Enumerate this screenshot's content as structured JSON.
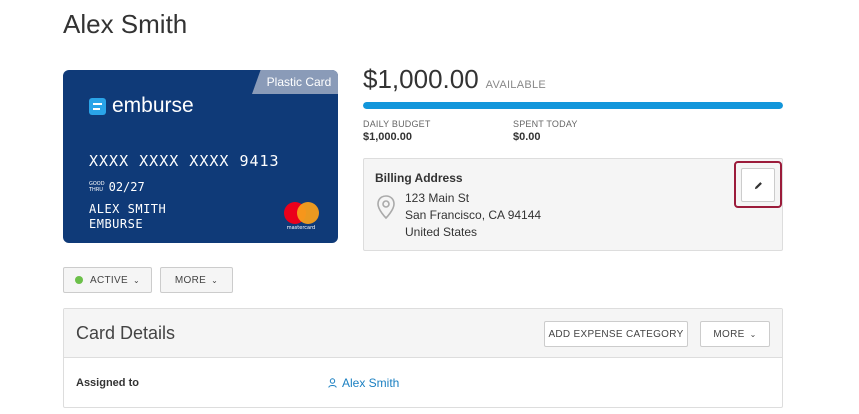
{
  "page": {
    "title": "Alex Smith"
  },
  "card": {
    "tab_label": "Plastic Card",
    "brand": "emburse",
    "number": "XXXX XXXX XXXX 9413",
    "good_thru_label_line1": "GOOD",
    "good_thru_label_line2": "THRU",
    "expiry": "02/27",
    "holder_line1": "ALEX SMITH",
    "holder_line2": "EMBURSE",
    "network_label": "mastercard",
    "colors": {
      "background": "#0f3a78",
      "tab": "#8a9bb8",
      "logo_mark": "#2aa4e8"
    }
  },
  "balance": {
    "amount": "$1,000.00",
    "label": "AVAILABLE",
    "progress_fraction": 1.0,
    "progress_color": "#1296db"
  },
  "stats": {
    "daily_budget_label": "DAILY BUDGET",
    "daily_budget_value": "$1,000.00",
    "spent_today_label": "SPENT TODAY",
    "spent_today_value": "$0.00"
  },
  "billing": {
    "title": "Billing Address",
    "line1": "123 Main St",
    "line2": "San Francisco, CA 94144",
    "line3": "United States",
    "edit_icon": "pencil-icon",
    "highlight_color": "#9b1b3a"
  },
  "actions": {
    "status_label": "ACTIVE",
    "status_color": "#6cc04a",
    "more_label": "MORE"
  },
  "details": {
    "title": "Card Details",
    "add_category_label": "ADD EXPENSE CATEGORY",
    "more_label": "MORE",
    "rows": [
      {
        "label": "Assigned to",
        "value": "Alex Smith",
        "icon": "user-icon"
      }
    ]
  }
}
